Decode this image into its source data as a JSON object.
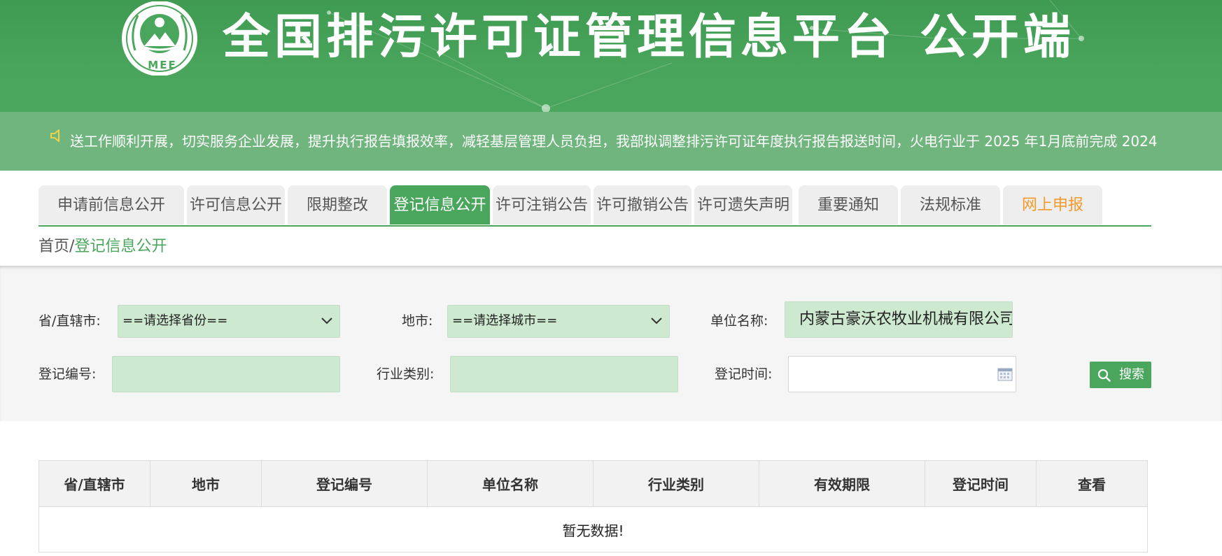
{
  "header": {
    "logo_text": "MEE",
    "title_main": "全国排污许可证管理信息平台",
    "title_sub": "公开端"
  },
  "notice": {
    "icon": "speaker-icon",
    "text": "送工作顺利开展，切实服务企业发展，提升执行报告填报效率，减轻基层管理人员负担，我部拟调整排污许可证年度执行报告报送时间，火电行业于 2025 年1月底前完成 2024"
  },
  "tabs": [
    {
      "label": "申请前信息公开",
      "active": false
    },
    {
      "label": "许可信息公开",
      "active": false
    },
    {
      "label": "限期整改",
      "active": false
    },
    {
      "label": "登记信息公开",
      "active": true
    },
    {
      "label": "许可注销公告",
      "active": false
    },
    {
      "label": "许可撤销公告",
      "active": false
    },
    {
      "label": "许可遗失声明",
      "active": false
    },
    {
      "label": "重要通知",
      "active": false
    },
    {
      "label": "法规标准",
      "active": false
    },
    {
      "label": "网上申报",
      "active": false,
      "color": "#f39a2a"
    }
  ],
  "breadcrumb": {
    "home": "首页",
    "separator": "/",
    "current": "登记信息公开"
  },
  "filters": {
    "province_label": "省/直辖市:",
    "province_value": "==请选择省份==",
    "city_label": "地市:",
    "city_value": "==请选择城市==",
    "unit_label": "单位名称:",
    "unit_value": "内蒙古豪沃农牧业机械有限公司",
    "reg_no_label": "登记编号:",
    "reg_no_value": "",
    "industry_label": "行业类别:",
    "industry_value": "",
    "reg_time_label": "登记时间:",
    "reg_time_value": "",
    "search_label": "搜索"
  },
  "table": {
    "headers": [
      "省/直辖市",
      "地市",
      "登记编号",
      "单位名称",
      "行业类别",
      "有效期限",
      "登记时间",
      "查看"
    ],
    "empty_text": "暂无数据!"
  },
  "colors": {
    "brand_green": "#4aa65c",
    "notice_green": "#6fb57d",
    "input_green": "#cde9cf",
    "accent_orange": "#f39a2a"
  }
}
